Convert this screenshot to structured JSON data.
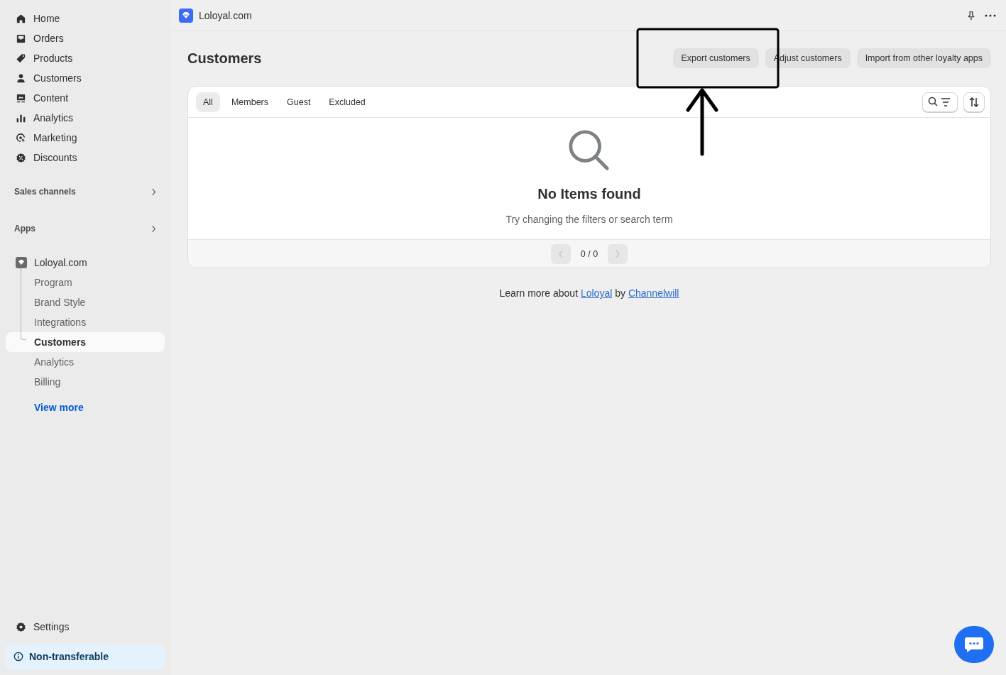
{
  "sidebar": {
    "nav": [
      {
        "label": "Home"
      },
      {
        "label": "Orders"
      },
      {
        "label": "Products"
      },
      {
        "label": "Customers"
      },
      {
        "label": "Content"
      },
      {
        "label": "Analytics"
      },
      {
        "label": "Marketing"
      },
      {
        "label": "Discounts"
      }
    ],
    "sections": [
      {
        "label": "Sales channels"
      },
      {
        "label": "Apps"
      }
    ],
    "app": {
      "label": "Loloyal.com",
      "children": [
        {
          "label": "Program",
          "selected": false
        },
        {
          "label": "Brand Style",
          "selected": false
        },
        {
          "label": "Integrations",
          "selected": false
        },
        {
          "label": "Customers",
          "selected": true
        },
        {
          "label": "Analytics",
          "selected": false
        },
        {
          "label": "Billing",
          "selected": false
        }
      ]
    },
    "view_more": "View more",
    "settings": "Settings",
    "notice": "Non-transferable"
  },
  "topbar": {
    "title": "Loloyal.com"
  },
  "page": {
    "title": "Customers",
    "actions": [
      "Export customers",
      "Adjust customers",
      "Import from other loyalty apps"
    ]
  },
  "tabs": [
    {
      "label": "All",
      "selected": true
    },
    {
      "label": "Members",
      "selected": false
    },
    {
      "label": "Guest",
      "selected": false
    },
    {
      "label": "Excluded",
      "selected": false
    }
  ],
  "empty": {
    "title": "No Items found",
    "hint": "Try changing the filters or search term"
  },
  "pagination": {
    "label": "0 / 0",
    "previous_disabled": true,
    "next_disabled": true
  },
  "footer": [
    {
      "kind": "text",
      "text": "Learn more about "
    },
    {
      "kind": "link",
      "text": "Loloyal"
    },
    {
      "kind": "text",
      "text": " by "
    },
    {
      "kind": "link",
      "text": "Channelwill"
    }
  ]
}
